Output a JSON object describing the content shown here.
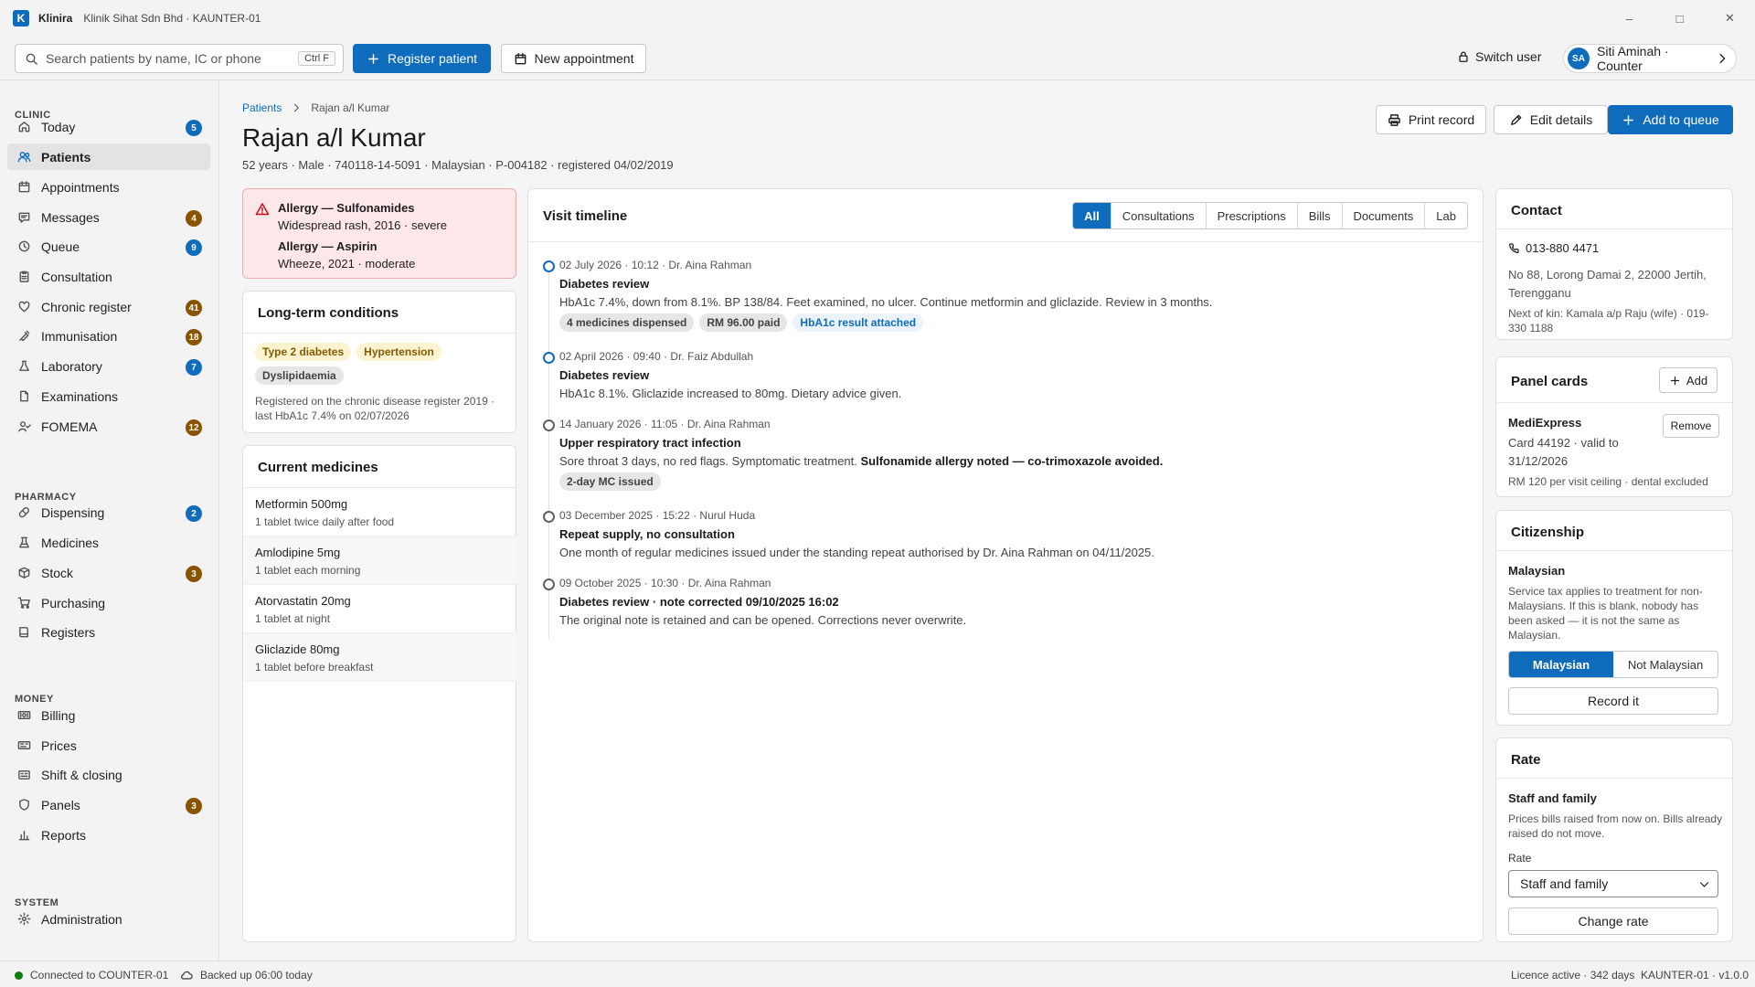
{
  "app": {
    "logo_letter": "K",
    "name": "Klinira",
    "context": "Klinik Sihat Sdn Bhd · KAUNTER-01",
    "window_controls": {
      "minimize": "–",
      "maximize": "□",
      "close": "✕"
    }
  },
  "toolbar": {
    "search_placeholder": "Search patients by name, IC or phone",
    "search_shortcut": "Ctrl F",
    "register_label": "Register patient",
    "new_appointment_label": "New appointment",
    "switch_user_label": "Switch user",
    "user_initials": "SA",
    "user_name": "Siti Aminah · Counter"
  },
  "sidebar": {
    "sections": [
      {
        "title": "CLINIC",
        "items": [
          {
            "label": "Today",
            "icon": "home-icon",
            "badge": "5",
            "badge_color": "blue"
          },
          {
            "label": "Patients",
            "icon": "people-icon",
            "active": true
          },
          {
            "label": "Appointments",
            "icon": "calendar-icon"
          },
          {
            "label": "Messages",
            "icon": "chat-icon",
            "badge": "4",
            "badge_color": "brown"
          },
          {
            "label": "Queue",
            "icon": "clock-icon",
            "badge": "9",
            "badge_color": "blue"
          },
          {
            "label": "Consultation",
            "icon": "clipboard-icon"
          },
          {
            "label": "Chronic register",
            "icon": "heart-icon",
            "badge": "41",
            "badge_color": "brown"
          },
          {
            "label": "Immunisation",
            "icon": "syringe-icon",
            "badge": "18",
            "badge_color": "brown"
          },
          {
            "label": "Laboratory",
            "icon": "flask-icon",
            "badge": "7",
            "badge_color": "blue"
          },
          {
            "label": "Examinations",
            "icon": "document-icon"
          },
          {
            "label": "FOMEMA",
            "icon": "person-check-icon",
            "badge": "12",
            "badge_color": "brown"
          }
        ]
      },
      {
        "title": "PHARMACY",
        "items": [
          {
            "label": "Dispensing",
            "icon": "pill-icon",
            "badge": "2",
            "badge_color": "blue"
          },
          {
            "label": "Medicines",
            "icon": "beaker-icon"
          },
          {
            "label": "Stock",
            "icon": "box-icon",
            "badge": "3",
            "badge_color": "brown"
          },
          {
            "label": "Purchasing",
            "icon": "cart-icon"
          },
          {
            "label": "Registers",
            "icon": "book-icon"
          }
        ]
      },
      {
        "title": "MONEY",
        "items": [
          {
            "label": "Billing",
            "icon": "money-icon"
          },
          {
            "label": "Prices",
            "icon": "tag-icon"
          },
          {
            "label": "Shift & closing",
            "icon": "register-icon"
          },
          {
            "label": "Panels",
            "icon": "shield-icon",
            "badge": "3",
            "badge_color": "brown"
          },
          {
            "label": "Reports",
            "icon": "bar-chart-icon"
          }
        ]
      },
      {
        "title": "SYSTEM",
        "items": [
          {
            "label": "Administration",
            "icon": "gear-icon"
          }
        ]
      }
    ]
  },
  "breadcrumb": {
    "root": "Patients",
    "current": "Rajan a/l Kumar"
  },
  "patient": {
    "name": "Rajan a/l Kumar",
    "summary": "52 years · Male · 740118-14-5091 · Malaysian · P-004182 · registered 04/02/2019"
  },
  "header_actions": {
    "print": "Print record",
    "edit": "Edit details",
    "queue": "Add to queue"
  },
  "allergies": [
    {
      "title": "Allergy — Sulfonamides",
      "detail": "Widespread rash, 2016 · severe"
    },
    {
      "title": "Allergy — Aspirin",
      "detail": "Wheeze, 2021 · moderate"
    }
  ],
  "conditions": {
    "title": "Long-term conditions",
    "tags": [
      {
        "label": "Type 2 diabetes",
        "color": "yellow"
      },
      {
        "label": "Hypertension",
        "color": "yellow"
      },
      {
        "label": "Dyslipidaemia",
        "color": "grey"
      }
    ],
    "note": "Registered on the chronic disease register 2019 · last HbA1c 7.4% on 02/07/2026"
  },
  "medicines": {
    "title": "Current medicines",
    "items": [
      {
        "name": "Metformin 500mg",
        "dose": "1 tablet twice daily after food"
      },
      {
        "name": "Amlodipine 5mg",
        "dose": "1 tablet each morning"
      },
      {
        "name": "Atorvastatin 20mg",
        "dose": "1 tablet at night"
      },
      {
        "name": "Gliclazide 80mg",
        "dose": "1 tablet before breakfast"
      }
    ]
  },
  "timeline": {
    "title": "Visit timeline",
    "tabs": [
      "All",
      "Consultations",
      "Prescriptions",
      "Bills",
      "Documents",
      "Lab"
    ],
    "active_tab": "All",
    "entries": [
      {
        "meta": "02 July 2026 · 10:12 · Dr. Aina Rahman",
        "title": "Diabetes review",
        "desc": "HbA1c 7.4%, down from 8.1%. BP 138/84. Feet examined, no ulcer. Continue metformin and gliclazide. Review in 3 months.",
        "tags": [
          {
            "label": "4 medicines dispensed",
            "color": "grey"
          },
          {
            "label": "RM 96.00 paid",
            "color": "grey"
          },
          {
            "label": "HbA1c result attached",
            "color": "blue"
          }
        ],
        "dot": "blue"
      },
      {
        "meta": "02 April 2026 · 09:40 · Dr. Faiz Abdullah",
        "title": "Diabetes review",
        "desc": "HbA1c 8.1%. Gliclazide increased to 80mg. Dietary advice given.",
        "tags": [],
        "dot": "blue"
      },
      {
        "meta": "14 January 2026 · 11:05 · Dr. Aina Rahman",
        "title": "Upper respiratory tract infection",
        "desc": "Sore throat 3 days, no red flags. Symptomatic treatment.",
        "desc_bold": "Sulfonamide allergy noted — co-trimoxazole avoided.",
        "tags": [
          {
            "label": "2-day MC issued",
            "color": "grey"
          }
        ],
        "dot": "grey"
      },
      {
        "meta": "03 December 2025 · 15:22 · Nurul Huda",
        "title": "Repeat supply, no consultation",
        "desc": "One month of regular medicines issued under the standing repeat authorised by Dr. Aina Rahman on 04/11/2025.",
        "tags": [],
        "dot": "grey"
      },
      {
        "meta": "09 October 2025 · 10:30 · Dr. Aina Rahman",
        "title": "Diabetes review · note corrected 09/10/2025 16:02",
        "desc": "The original note is retained and can be opened. Corrections never overwrite.",
        "tags": [],
        "dot": "grey"
      }
    ]
  },
  "contact": {
    "title": "Contact",
    "phone": "013-880 4471",
    "address": "No 88, Lorong Damai 2, 22000 Jertih, Terengganu",
    "next_of_kin": "Next of kin: Kamala a/p Raju (wife) · 019-330 1188"
  },
  "panel_cards": {
    "title": "Panel cards",
    "add_label": "Add",
    "card_name": "MediExpress",
    "remove_label": "Remove",
    "card_detail": "Card 44192 · valid to 31/12/2026",
    "card_note": "RM 120 per visit ceiling · dental excluded"
  },
  "citizenship": {
    "title": "Citizenship",
    "value": "Malaysian",
    "note": "Service tax applies to treatment for non-Malaysians. If this is blank, nobody has been asked — it is not the same as Malaysian.",
    "options": [
      "Malaysian",
      "Not Malaysian"
    ],
    "selected": "Malaysian",
    "record_label": "Record it"
  },
  "rate": {
    "title": "Rate",
    "value": "Staff and family",
    "note": "Prices bills raised from now on. Bills already raised do not move.",
    "field_label": "Rate",
    "selected": "Staff and family",
    "change_label": "Change rate"
  },
  "status": {
    "connection": "Connected to COUNTER-01",
    "backup": "Backed up 06:00 today",
    "licence": "Licence active · 342 days",
    "version": "KAUNTER-01 · v1.0.0"
  },
  "colors": {
    "accent": "#0f6cbd",
    "danger": "#c50f1f",
    "warning_badge": "#8a5300",
    "ok": "#107c10"
  }
}
